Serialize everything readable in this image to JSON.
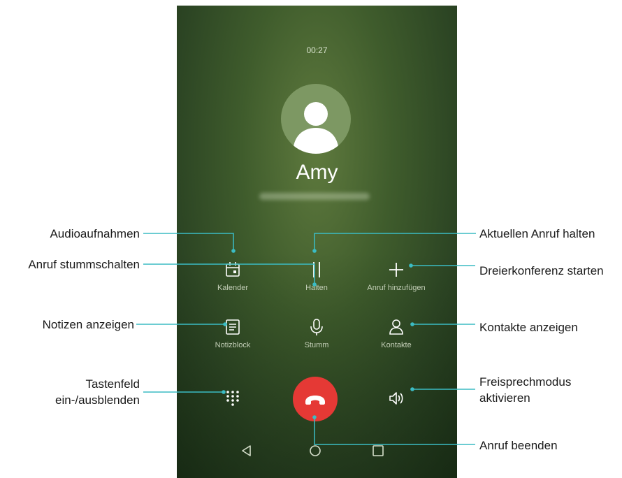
{
  "call": {
    "timer": "00:27",
    "contact_name": "Amy"
  },
  "controls": {
    "row1": [
      {
        "label": "Kalender",
        "icon": "calendar-icon"
      },
      {
        "label": "Halten",
        "icon": "pause-icon"
      },
      {
        "label": "Anruf hinzufügen",
        "icon": "plus-icon"
      }
    ],
    "row2": [
      {
        "label": "Notizblock",
        "icon": "notepad-icon"
      },
      {
        "label": "Stumm",
        "icon": "microphone-icon"
      },
      {
        "label": "Kontakte",
        "icon": "person-icon"
      }
    ],
    "row3": {
      "left_icon": "dialpad-icon",
      "center_icon": "end-call-icon",
      "right_icon": "speaker-icon"
    }
  },
  "navigation": {
    "back_icon": "back-triangle-icon",
    "home_icon": "home-circle-icon",
    "recents_icon": "recents-square-icon"
  },
  "annotations": {
    "audio_recordings": "Audioaufnahmen",
    "mute_call": "Anruf stummschalten",
    "show_notes": "Notizen anzeigen",
    "dialpad_line1": "Tastenfeld",
    "dialpad_line2": "ein-/ausblenden",
    "hold_call": "Aktuellen Anruf halten",
    "conference": "Dreierkonferenz starten",
    "show_contacts": "Kontakte anzeigen",
    "speaker_line1": "Freisprechmodus",
    "speaker_line2": "aktivieren",
    "end_call": "Anruf beenden"
  },
  "colors": {
    "accent_teal": "#3bbcc4",
    "end_call_red": "#e53935",
    "background_green": "#3f5c2c"
  }
}
